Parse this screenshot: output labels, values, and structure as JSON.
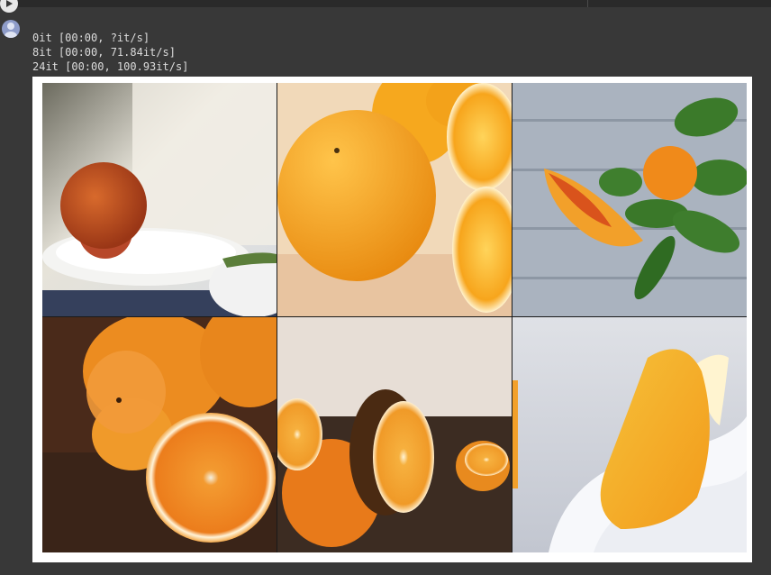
{
  "cell_toolbar": {
    "run_icon": "play-icon",
    "avatar_icon": "user-avatar-icon"
  },
  "output": {
    "lines": [
      "0it [00:00, ?it/s]",
      "8it [00:00, 71.84it/s]",
      "24it [00:00, 100.93it/s]"
    ]
  },
  "figure": {
    "images": [
      {
        "subject": "orange-on-plate"
      },
      {
        "subject": "whole-oranges"
      },
      {
        "subject": "orange-with-leaves"
      },
      {
        "subject": "orange-slices"
      },
      {
        "subject": "cut-orange-halves"
      },
      {
        "subject": "mango-slice"
      }
    ]
  },
  "colors": {
    "background": "#383838",
    "text": "#dcdcdc",
    "figure_bg": "#ffffff"
  }
}
